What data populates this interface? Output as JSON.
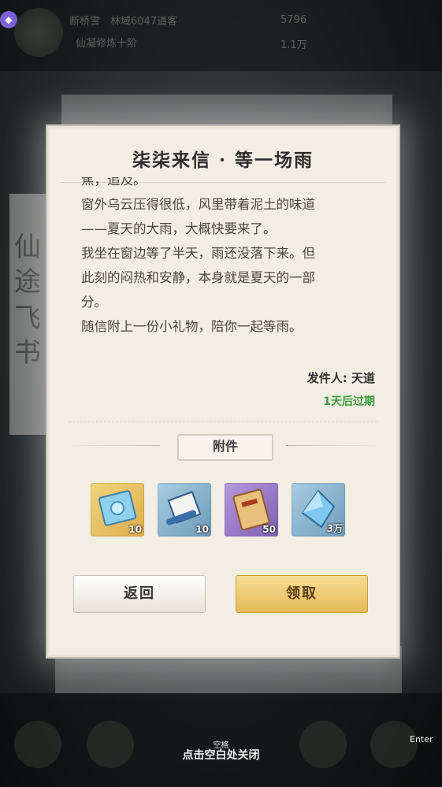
{
  "background": {
    "player_name": "断桥雪",
    "server": "林域6047道客",
    "subtitle": "仙凝修炼十阶",
    "currency_1": "5796",
    "currency_2": "1.1万",
    "vertical_title": [
      "仙",
      "途",
      "飞",
      "书"
    ]
  },
  "modal": {
    "title": "柒柒来信 · 等一场雨",
    "letter_lines": [
      "焦，追及。",
      "窗外乌云压得很低，风里带着泥土的味道",
      "——夏天的大雨，大概快要来了。",
      "我坐在窗边等了半天，雨还没落下来。但",
      "此刻的闷热和安静，本身就是夏天的一部",
      "分。",
      "随信附上一份小礼物，陪你一起等雨。"
    ],
    "sender": "发件人: 天道",
    "expire": "1天后过期",
    "attachments_label": "附件",
    "items": [
      {
        "icon": "blue-talisman-card-icon",
        "count": "10",
        "color": "#e8c46a"
      },
      {
        "icon": "scroll-icon",
        "count": "10",
        "color": "#7fa8c4"
      },
      {
        "icon": "golden-token-icon",
        "count": "50",
        "color": "#9b7cc6"
      },
      {
        "icon": "spirit-crystal-icon",
        "count": "3万",
        "color": "#8bb4cf"
      }
    ],
    "back_label": "返回",
    "claim_label": "领取"
  },
  "overlay": {
    "close_hint": "点击空白处关闭",
    "space_key": "空格",
    "enter_key": "Enter"
  }
}
